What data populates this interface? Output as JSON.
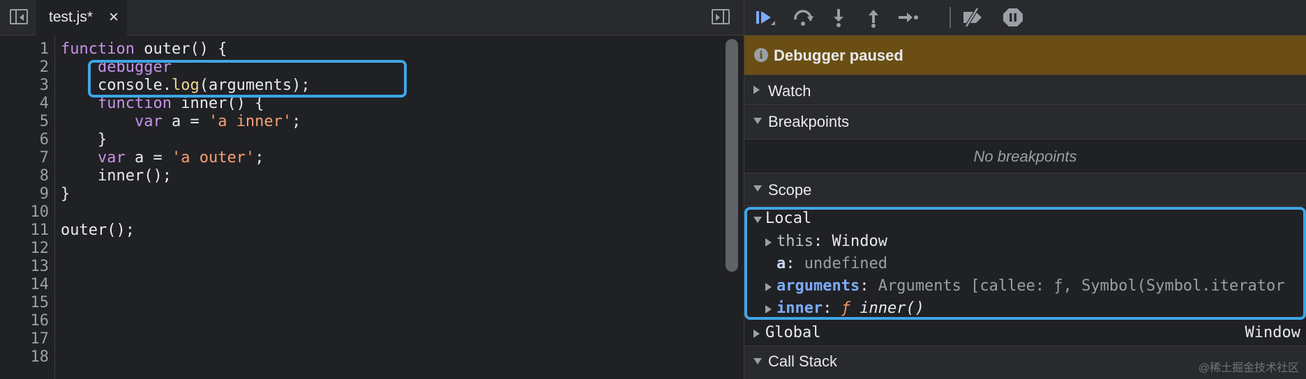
{
  "editor": {
    "tab": {
      "label": "test.js*",
      "close": "×"
    },
    "line_numbers": [
      "1",
      "2",
      "3",
      "4",
      "5",
      "6",
      "7",
      "8",
      "9",
      "10",
      "11",
      "12",
      "13",
      "14",
      "15",
      "16",
      "17",
      "18"
    ],
    "code": {
      "l1": {
        "kw": "function",
        "rest": " outer() {"
      },
      "l2": {
        "indent": "    ",
        "kw": "debugger"
      },
      "l3": {
        "indent": "    ",
        "a": "console.",
        "b": "log",
        "c": "(arguments);"
      },
      "l4": {
        "indent": "    ",
        "kw": "function",
        "rest": " inner() {"
      },
      "l5": {
        "indent": "        ",
        "kw": "var",
        "mid": " a = ",
        "str": "'a inner'",
        "end": ";"
      },
      "l6": {
        "text": "    }"
      },
      "l7": {
        "indent": "    ",
        "kw": "var",
        "mid": " a = ",
        "str": "'a outer'",
        "end": ";"
      },
      "l8": {
        "text": "    inner();"
      },
      "l9": {
        "text": "}"
      },
      "l11": {
        "text": "outer();"
      }
    }
  },
  "debugger": {
    "paused_label": "Debugger paused",
    "paused_icon": "i",
    "sections": {
      "watch": "Watch",
      "breakpoints": "Breakpoints",
      "no_breakpoints": "No breakpoints",
      "scope": "Scope",
      "call_stack": "Call Stack"
    },
    "scope": {
      "local": "Local",
      "this_name": "this",
      "this_value": "Window",
      "a_name": "a",
      "a_value": "undefined",
      "arguments_name": "arguments",
      "arguments_value": "Arguments [callee: ƒ, Symbol(Symbol.iterator",
      "inner_name": "inner",
      "inner_f": "ƒ",
      "inner_sig": "inner()",
      "global": "Global",
      "global_value": "Window"
    },
    "colon": ": "
  },
  "watermark": "@稀土掘金技术社区",
  "colors": {
    "accent": "#3ea6e6",
    "paused_bg": "#6a4e14",
    "keyword": "#c792ea",
    "string": "#f6a174"
  }
}
